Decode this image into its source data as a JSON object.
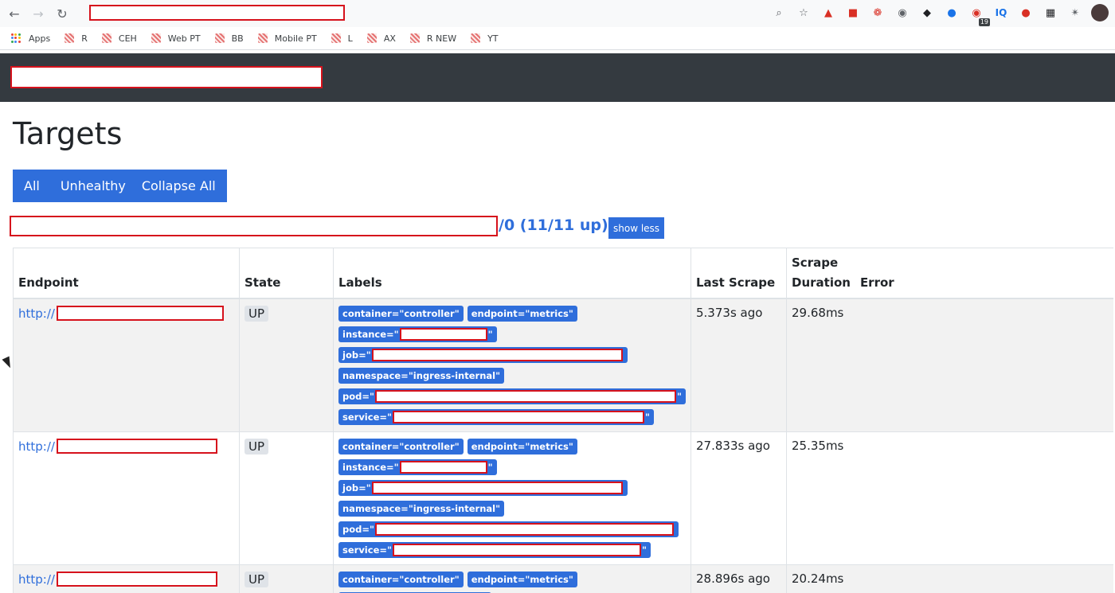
{
  "browser": {
    "bookmarks": [
      "Apps",
      "R",
      "CEH",
      "Web PT",
      "BB",
      "Mobile PT",
      "L",
      "AX",
      "R NEW",
      "YT"
    ],
    "extension_badge": "19",
    "iq_label": "IQ"
  },
  "page": {
    "title": "Targets",
    "filter_buttons": [
      "All",
      "Unhealthy",
      "Collapse All"
    ],
    "job_suffix": "/0 (11/11 up)",
    "show_less": "show less"
  },
  "table": {
    "headers": {
      "endpoint": "Endpoint",
      "state": "State",
      "labels": "Labels",
      "last_scrape": "Last Scrape",
      "scrape_duration": "Scrape Duration",
      "error": "Error"
    },
    "rows": [
      {
        "endpoint_prefix": "http://",
        "state": "UP",
        "label_container": "container=\"controller\"",
        "label_endpoint": "endpoint=\"metrics\"",
        "label_instance": "instance=\"",
        "label_job": "job=\"",
        "label_namespace": "namespace=\"ingress-internal\"",
        "label_pod": "pod=\"",
        "label_service": "service=\"",
        "quote": "\"",
        "last_scrape": "5.373s ago",
        "duration": "29.68ms",
        "error": ""
      },
      {
        "endpoint_prefix": "http://",
        "state": "UP",
        "label_container": "container=\"controller\"",
        "label_endpoint": "endpoint=\"metrics\"",
        "label_instance": "instance=\"",
        "label_job": "job=\"",
        "label_namespace": "namespace=\"ingress-internal\"",
        "label_pod": "pod=\"",
        "label_service": "service=\"",
        "quote": "\"",
        "last_scrape": "27.833s ago",
        "duration": "25.35ms",
        "error": ""
      },
      {
        "endpoint_prefix": "http://",
        "state": "UP",
        "label_container": "container=\"controller\"",
        "label_endpoint": "endpoint=\"metrics\"",
        "last_scrape": "28.896s ago",
        "duration": "20.24ms",
        "error": ""
      }
    ]
  },
  "colors": {
    "accent": "#2f6edb",
    "navbar": "#343a40",
    "redaction": "#d6121c"
  }
}
